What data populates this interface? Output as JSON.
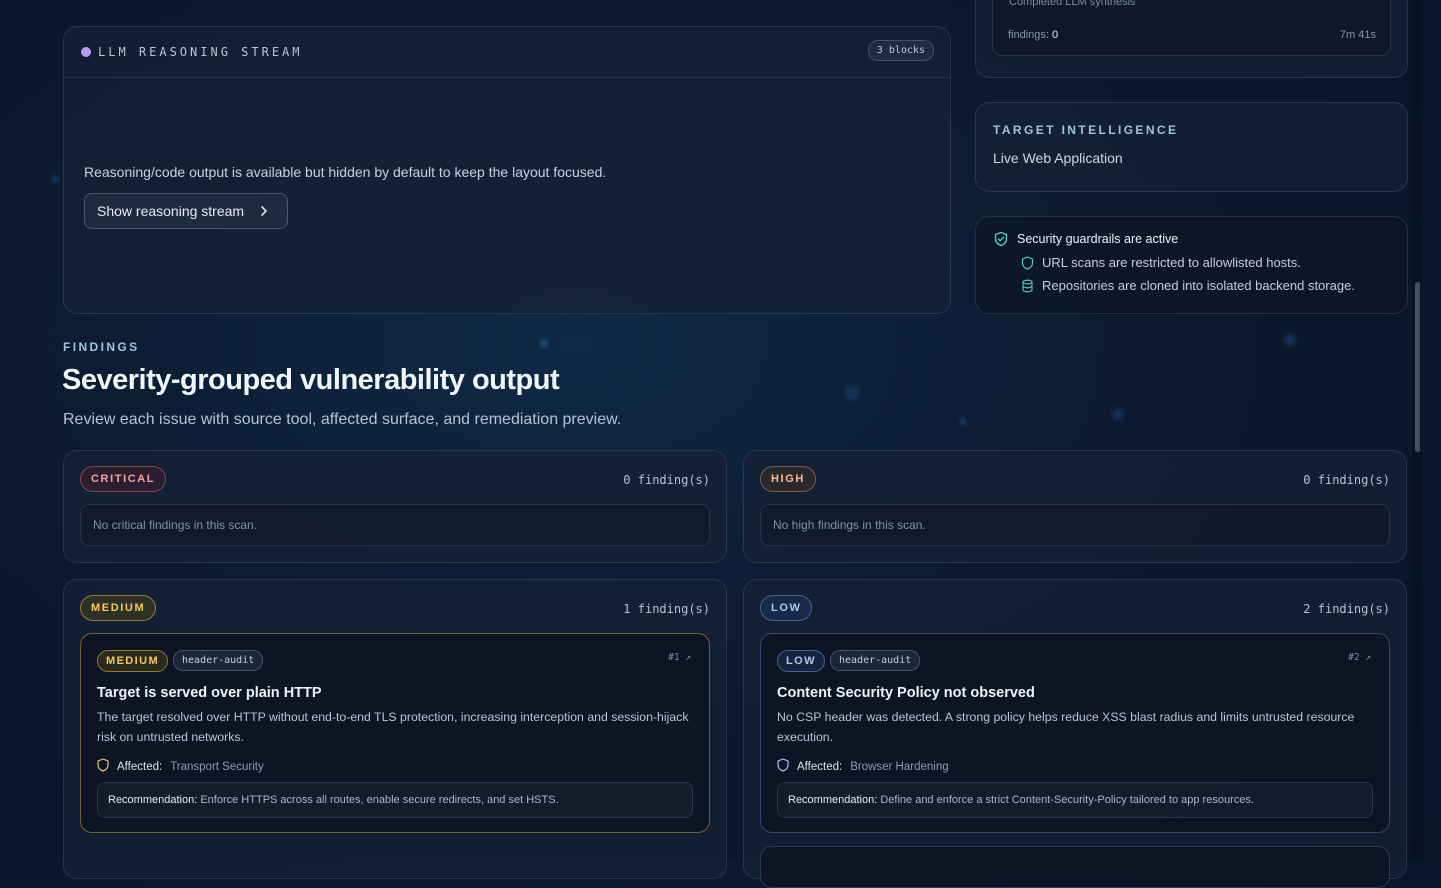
{
  "reasoning": {
    "title": "LLM REASONING STREAM",
    "badge": "3 blocks",
    "note": "Reasoning/code output is available but hidden by default to keep the layout focused.",
    "button_label": "Show reasoning stream"
  },
  "synthesis": {
    "cut_text": "Completed LLM synthesis",
    "findings_label": "findings:",
    "findings_value": "0",
    "elapsed": "7m 41s"
  },
  "target_intel": {
    "label": "TARGET INTELLIGENCE",
    "value": "Live Web Application"
  },
  "guardrails": {
    "title": "Security guardrails are active",
    "items": [
      "URL scans are restricted to allowlisted hosts.",
      "Repositories are cloned into isolated backend storage."
    ]
  },
  "findings_section": {
    "eyebrow": "FINDINGS",
    "title": "Severity-grouped vulnerability output",
    "subtitle": "Review each issue with source tool, affected surface, and remediation preview."
  },
  "severity_groups": [
    {
      "label": "CRITICAL",
      "count": "0 finding(s)",
      "empty": "No critical findings in this scan."
    },
    {
      "label": "HIGH",
      "count": "0 finding(s)",
      "empty": "No high findings in this scan."
    },
    {
      "label": "MEDIUM",
      "count": "1 finding(s)",
      "card": {
        "chip": "MEDIUM",
        "tool": "header-audit",
        "num": "#1 ↗",
        "title": "Target is served over plain HTTP",
        "desc": "The target resolved over HTTP without end-to-end TLS protection, increasing interception and session-hijack risk on untrusted networks.",
        "affected_label": "Affected:",
        "affected": "Transport Security",
        "rec_label": "Recommendation:",
        "rec": "Enforce HTTPS across all routes, enable secure redirects, and set HSTS."
      }
    },
    {
      "label": "LOW",
      "count": "2 finding(s)",
      "card": {
        "chip": "LOW",
        "tool": "header-audit",
        "num": "#2 ↗",
        "title": "Content Security Policy not observed",
        "desc": "No CSP header was detected. A strong policy helps reduce XSS blast radius and limits untrusted resource execution.",
        "affected_label": "Affected:",
        "affected": "Browser Hardening",
        "rec_label": "Recommendation:",
        "rec": "Define and enforce a strict Content-Security-Policy tailored to app resources."
      }
    }
  ],
  "colors": {
    "accent": "#9ec4df",
    "pulse": "#b79cf7",
    "medium": "#f3cc5a",
    "low": "#a9c8f3",
    "guard_icon": "#4fd1c5"
  }
}
